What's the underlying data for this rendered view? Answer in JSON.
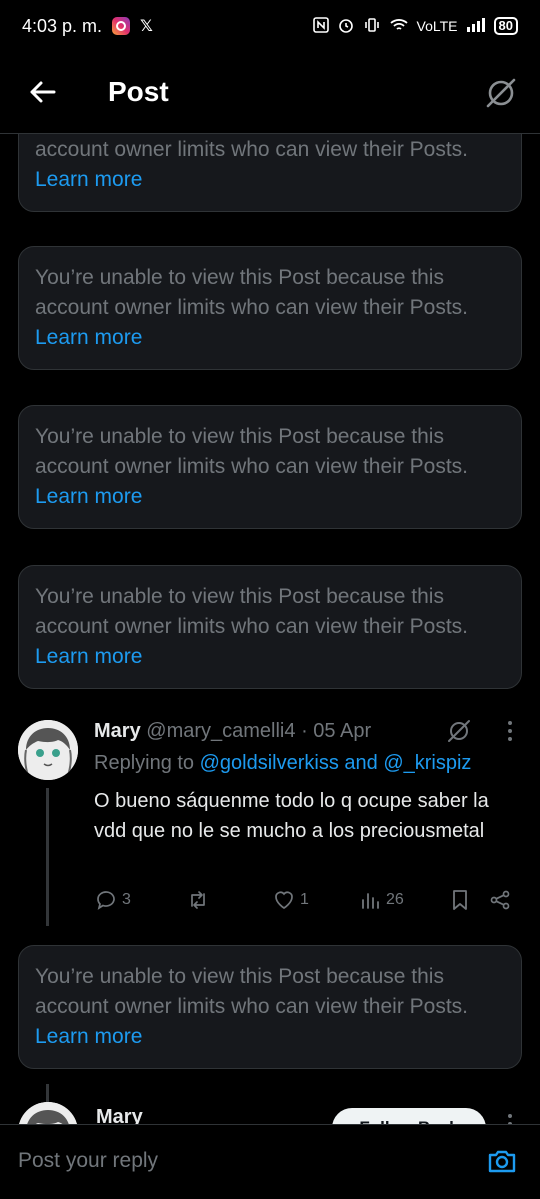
{
  "status_bar": {
    "time": "4:03 p. m.",
    "network": "VoLTE",
    "battery": "80"
  },
  "header": {
    "title": "Post"
  },
  "restricted": {
    "message": "You’re unable to view this Post because this account owner limits who can view their Posts.",
    "partial_message": "account owner limits who can view their Posts.",
    "link": "Learn more"
  },
  "tweet": {
    "name": "Mary",
    "handle": "@mary_camelli4",
    "separator": "·",
    "date": "05 Apr",
    "replying_prefix": "Replying to",
    "replying_mentions": "@goldsilverkiss and @_krispiz",
    "text": "O bueno sáquenme todo lo q ocupe saber la vdd que no le se mucho a los preciousmetal",
    "replies": "3",
    "retweets": "",
    "likes": "1",
    "views": "26"
  },
  "next_tweet": {
    "name": "Mary",
    "follow_label": "Follow Back"
  },
  "composer": {
    "placeholder": "Post your reply"
  },
  "colors": {
    "accent": "#1d9bf0",
    "card_bg": "#16181c",
    "muted": "#71767b"
  }
}
